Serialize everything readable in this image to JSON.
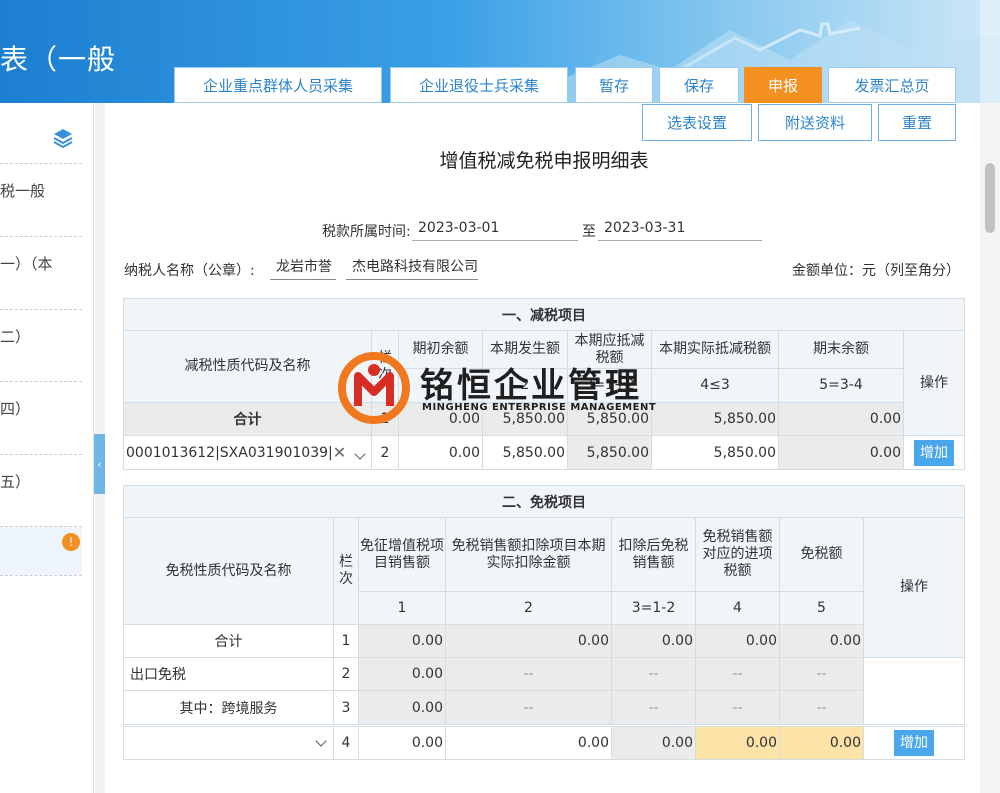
{
  "header": {
    "title": "表（一般"
  },
  "toolbar": {
    "buttons": [
      "企业重点群体人员采集",
      "企业退役士兵采集",
      "暂存",
      "保存",
      "申报",
      "发票汇总页"
    ],
    "sub_buttons": [
      "选表设置",
      "附送资料",
      "重置"
    ]
  },
  "sidebar": {
    "items": [
      "税一般",
      "一）（本",
      "二）",
      "四）",
      "五）",
      ""
    ],
    "badge": "!"
  },
  "form": {
    "title": "增值税减免税申报明细表",
    "period_label": "税款所属时间:",
    "period_start": "2023-03-01",
    "period_to": "至",
    "period_end": "2023-03-31",
    "taxpayer_label": "纳税人名称（公章）:",
    "taxpayer_name_1": "龙岩市誉",
    "taxpayer_name_2": "杰电路科技有限公司",
    "unit_label": "金额单位：元（列至角分）"
  },
  "reduction": {
    "title": "一、减税项目",
    "h_name": "减税性质代码及名称",
    "h_seq": "栏次",
    "h_c1": "期初余额",
    "h_c2": "本期发生额",
    "h_c3": "本期应抵减税额",
    "h_c4": "本期实际抵减税额",
    "h_c5": "期末余额",
    "h_op": "操作",
    "f_c1": "1",
    "f_c2": "2",
    "f_c3": "3=1+2",
    "f_c4": "4≤3",
    "f_c5": "5=3-4",
    "total": {
      "name": "合计",
      "seq": "1",
      "c1": "0.00",
      "c2": "5,850.00",
      "c3": "5,850.00",
      "c4": "5,850.00",
      "c5": "0.00"
    },
    "row": {
      "code": "0001013612|SXA031901039|",
      "seq": "2",
      "c1": "0.00",
      "c2": "5,850.00",
      "c3": "5,850.00",
      "c4": "5,850.00",
      "c5": "0.00",
      "add": "增加"
    }
  },
  "exemption": {
    "title": "二、免税项目",
    "h_name": "免税性质代码及名称",
    "h_seq": "栏次",
    "h_c1": "免征增值税项目销售额",
    "h_c2": "免税销售额扣除项目本期实际扣除金额",
    "h_c3": "扣除后免税销售额",
    "h_c4": "免税销售额对应的进项税额",
    "h_c5": "免税额",
    "h_op": "操作",
    "f_c1": "1",
    "f_c2": "2",
    "f_c3": "3=1-2",
    "f_c4": "4",
    "f_c5": "5",
    "rows": [
      {
        "name": "合计",
        "seq": "1",
        "c1": "0.00",
        "c2": "0.00",
        "c3": "0.00",
        "c4": "0.00",
        "c5": "0.00"
      },
      {
        "name": "出口免税",
        "seq": "2",
        "c1": "0.00",
        "c2": "--",
        "c3": "--",
        "c4": "--",
        "c5": "--"
      },
      {
        "name": "其中：跨境服务",
        "seq": "3",
        "c1": "0.00",
        "c2": "--",
        "c3": "--",
        "c4": "--",
        "c5": "--"
      },
      {
        "name": "",
        "seq": "4",
        "c1": "0.00",
        "c2": "0.00",
        "c3": "0.00",
        "c4": "0.00",
        "c5": "0.00"
      }
    ],
    "add": "增加"
  },
  "watermark": {
    "cn": "铭恒企业管理",
    "en": "MINGHENG ENTERPRISE MANAGEMENT"
  }
}
